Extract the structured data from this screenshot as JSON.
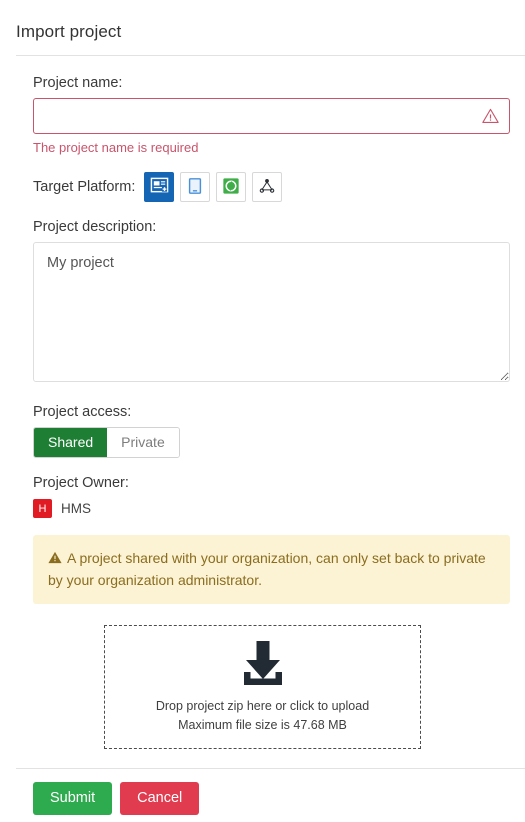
{
  "header": {
    "title": "Import project"
  },
  "form": {
    "project_name": {
      "label": "Project name:",
      "value": "",
      "placeholder": "",
      "error": "The project name is required",
      "error_icon": "warning-triangle-icon",
      "border_color": "#c9546b"
    },
    "target_platform": {
      "label": "Target Platform:",
      "options": [
        {
          "name": "desktop-window-platform",
          "icon": "window-screen-icon",
          "selected": true,
          "color": "#1565b5"
        },
        {
          "name": "mobile-tablet-platform",
          "icon": "tablet-device-icon",
          "selected": false,
          "color": "#4a90d9"
        },
        {
          "name": "sync-platform",
          "icon": "green-refresh-icon",
          "selected": false,
          "color": "#3fae49"
        },
        {
          "name": "network-platform",
          "icon": "network-nodes-icon",
          "selected": false,
          "color": "#2b3036"
        }
      ]
    },
    "project_description": {
      "label": "Project description:",
      "value": "My project",
      "placeholder": ""
    },
    "project_access": {
      "label": "Project access:",
      "options": [
        "Shared",
        "Private"
      ],
      "selected": "Shared",
      "selected_color": "#1e7e34"
    },
    "project_owner": {
      "label": "Project Owner:",
      "avatar_initial": "H",
      "avatar_color": "#e01b24",
      "name": "HMS"
    },
    "alert": {
      "icon": "warning-triangle-icon",
      "text": "A project shared with your organization, can only set back to private by your organization administrator.",
      "background": "#fcf3d4",
      "text_color": "#8a6d1f"
    },
    "dropzone": {
      "icon": "download-tray-icon",
      "primary_text": "Drop project zip here or click to upload",
      "secondary_text": "Maximum file size is 47.68 MB"
    }
  },
  "footer": {
    "submit_label": "Submit",
    "cancel_label": "Cancel",
    "submit_color": "#2eaa4f",
    "cancel_color": "#e13b4f"
  }
}
